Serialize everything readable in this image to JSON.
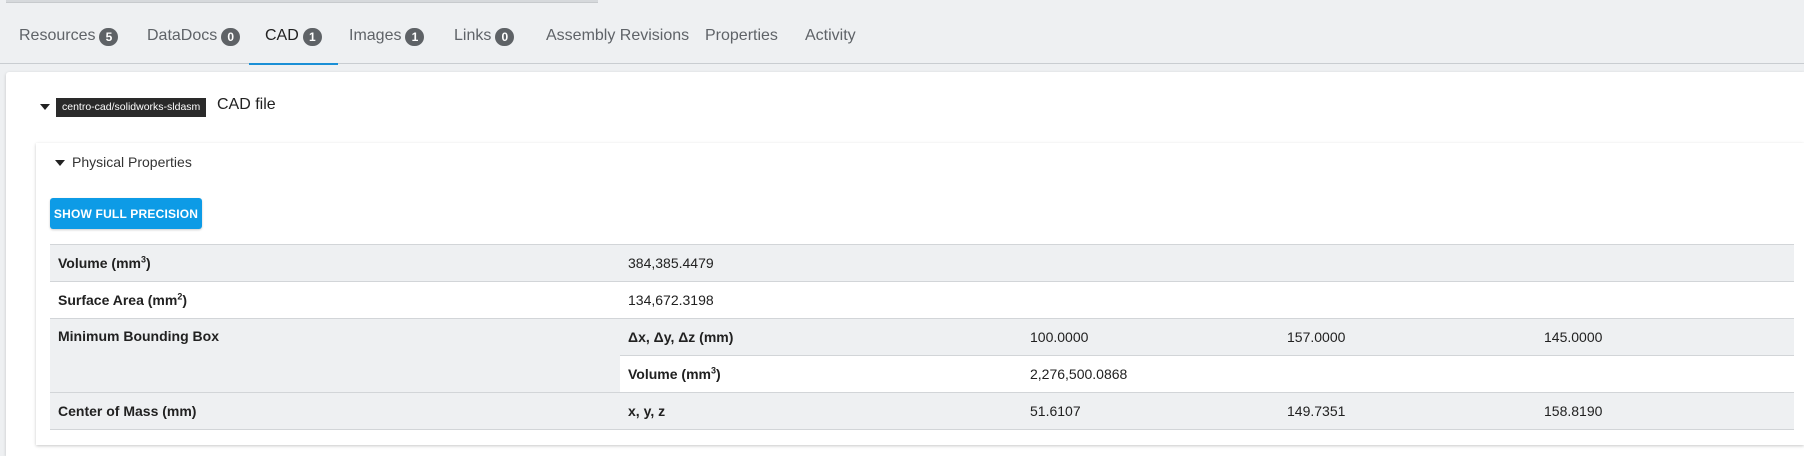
{
  "tabs": [
    {
      "label": "Resources",
      "count": "5"
    },
    {
      "label": "DataDocs",
      "count": "0"
    },
    {
      "label": "CAD",
      "count": "1"
    },
    {
      "label": "Images",
      "count": "1"
    },
    {
      "label": "Links",
      "count": "0"
    },
    {
      "label": "Assembly Revisions"
    },
    {
      "label": "Properties"
    },
    {
      "label": "Activity"
    }
  ],
  "active_tab": "CAD",
  "cad": {
    "format_tag": "centro-cad/solidworks-sldasm",
    "title": "CAD file"
  },
  "physical": {
    "section_title": "Physical Properties",
    "button_label": "SHOW FULL PRECISION",
    "rows": {
      "volume": {
        "label": "Volume (mm",
        "unit_exp": "3",
        "label_end": ")",
        "value": "384,385.4479"
      },
      "surface_area": {
        "label": "Surface Area (mm",
        "unit_exp": "2",
        "label_end": ")",
        "value": "134,672.3198"
      },
      "bbox": {
        "label": "Minimum Bounding Box",
        "dims_label": "Δx, Δy, Δz (mm)",
        "dx": "100.0000",
        "dy": "157.0000",
        "dz": "145.0000",
        "vol_label": "Volume (mm",
        "vol_exp": "3",
        "vol_end": ")",
        "vol_value": "2,276,500.0868"
      },
      "center_of_mass": {
        "label": "Center of Mass (mm)",
        "coords_label": "x, y, z",
        "x": "51.6107",
        "y": "149.7351",
        "z": "158.8190"
      }
    }
  }
}
